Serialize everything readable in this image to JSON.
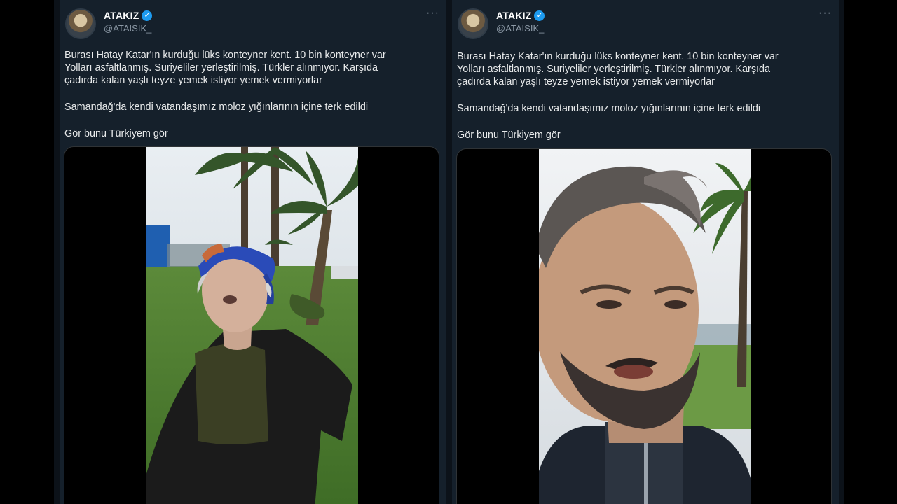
{
  "tweets": [
    {
      "author": {
        "name": "ATAKIZ",
        "handle": "@ATAISIK_",
        "verified": true
      },
      "more_icon": "more-horizontal-icon",
      "text_lines": [
        "Burası Hatay Katar'ın kurduğu lüks konteyner kent. 10 bin konteyner var",
        "Yolları asfaltlanmış. Suriyeliler yerleştirilmiş. Türkler alınmıyor. Karşıda",
        "çadırda kalan yaşlı teyze yemek istiyor yemek vermiyorlar"
      ],
      "text_p2": "Samandağ'da kendi vatandaşımız moloz yığınlarının içine terk edildi",
      "text_p3": "Gör bunu Türkiyem gör",
      "media": {
        "type": "video",
        "subject": "elderly woman with blue headscarf in garden with palm trees"
      }
    },
    {
      "author": {
        "name": "ATAKIZ",
        "handle": "@ATAISIK_",
        "verified": true
      },
      "more_icon": "more-horizontal-icon",
      "text_lines": [
        "Burası Hatay Katar'ın kurduğu lüks konteyner kent. 10 bin konteyner var",
        "Yolları asfaltlanmış. Suriyeliler yerleştirilmiş. Türkler alınmıyor. Karşıda",
        "çadırda kalan yaşlı teyze yemek istiyor yemek vermiyorlar"
      ],
      "text_p2": "Samandağ'da kendi vatandaşımız moloz yığınlarının içine terk edildi",
      "text_p3": "Gör bunu Türkiyem gör",
      "media": {
        "type": "video",
        "subject": "close-up of a man with beard outdoors near palm trees"
      }
    }
  ],
  "colors": {
    "background": "#15202b",
    "text": "#e7e9ea",
    "muted": "#8b98a5",
    "verified_blue": "#1d9bf0"
  }
}
